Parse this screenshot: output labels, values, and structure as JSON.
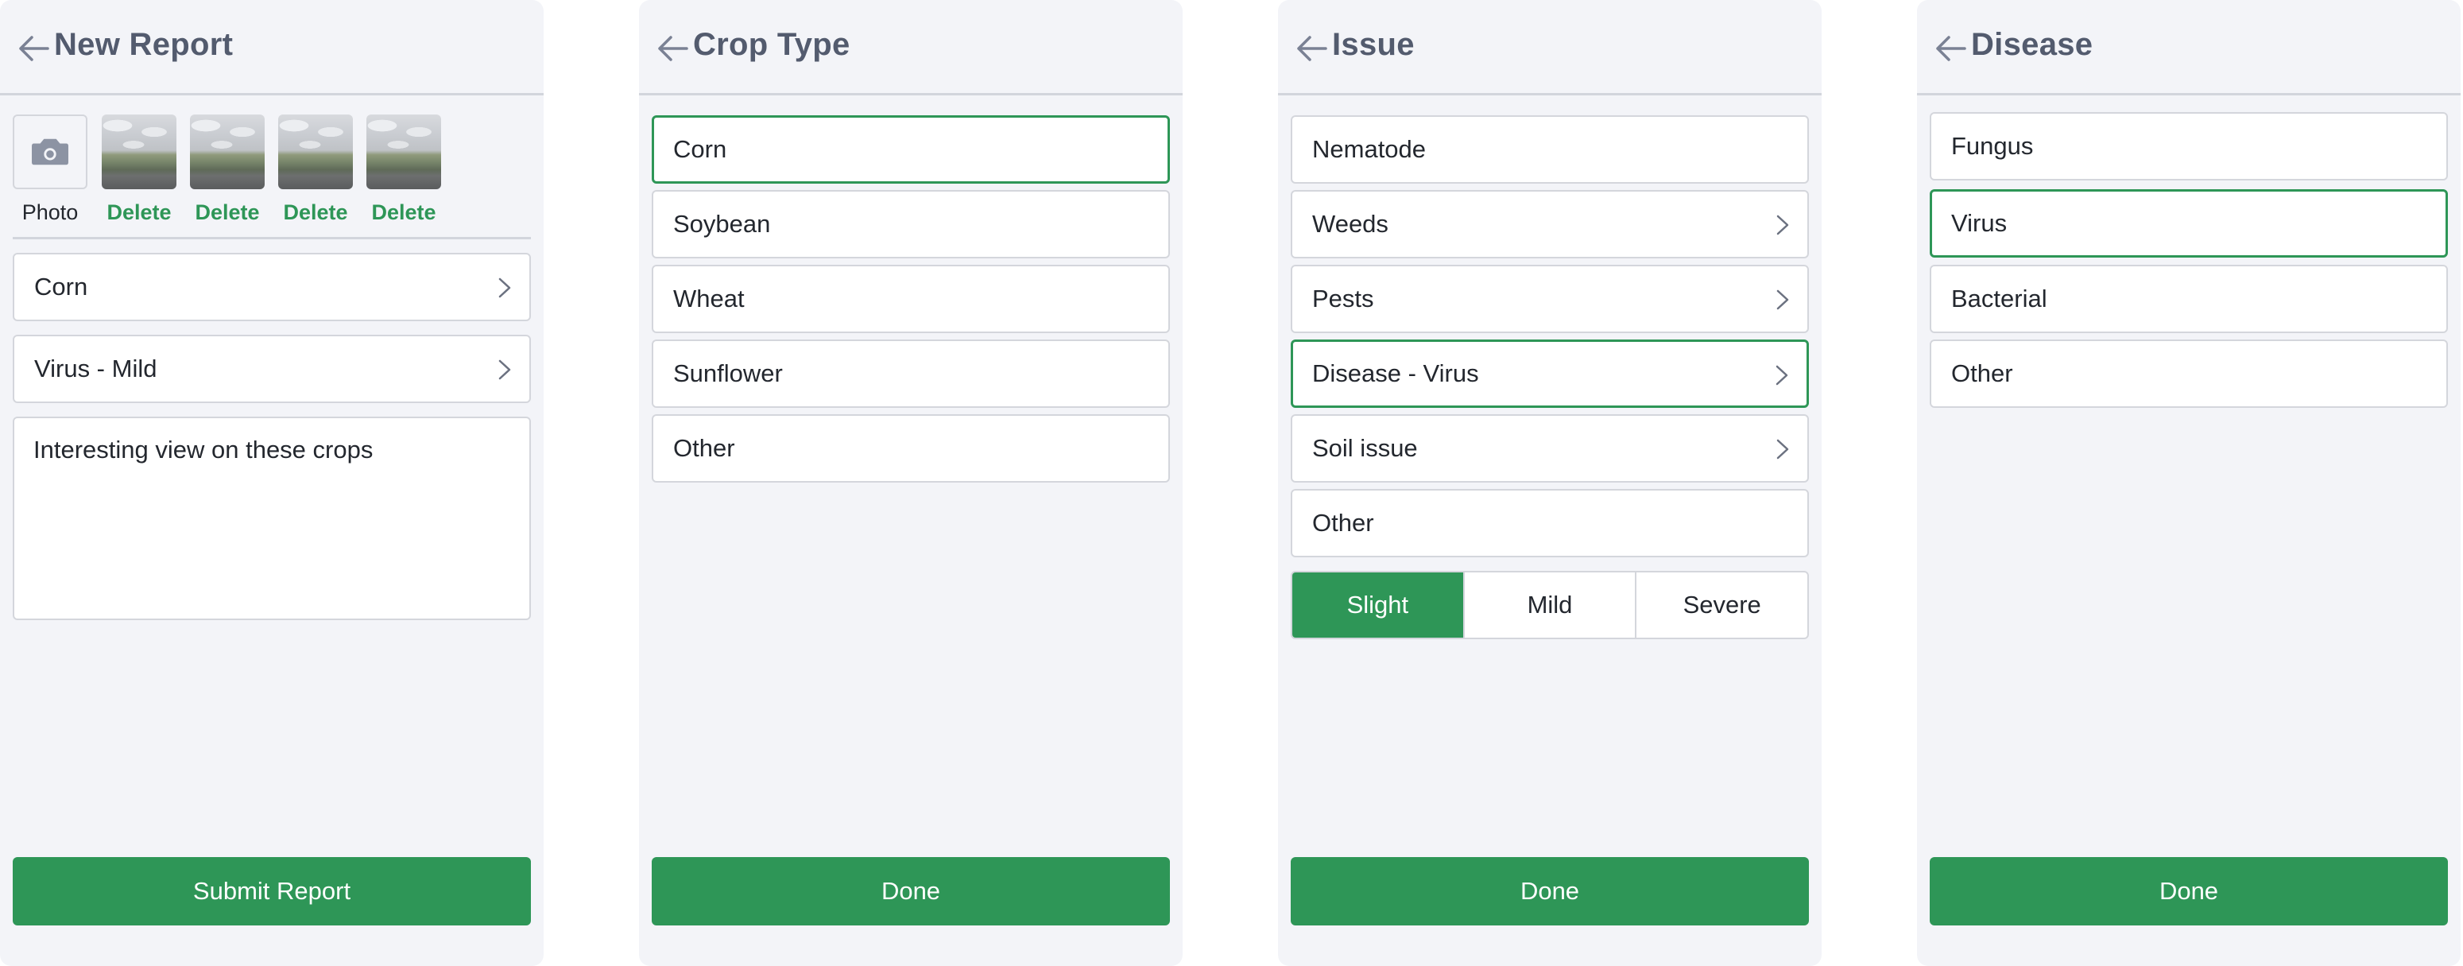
{
  "colors": {
    "accent": "#2e9657",
    "panel_bg": "#f3f4f8",
    "title": "#535b6e",
    "border": "#d4d6dc"
  },
  "new_report": {
    "title": "New Report",
    "photo_label": "Photo",
    "photo_icon": "camera-icon",
    "delete_labels": [
      "Delete",
      "Delete",
      "Delete",
      "Delete"
    ],
    "crop_value": "Corn",
    "issue_value": "Virus - Mild",
    "notes_value": "Interesting view on these crops",
    "submit_label": "Submit Report"
  },
  "crop_type": {
    "title": "Crop Type",
    "options": [
      "Corn",
      "Soybean",
      "Wheat",
      "Sunflower",
      "Other"
    ],
    "selected": "Corn",
    "done_label": "Done"
  },
  "issue": {
    "title": "Issue",
    "options": [
      "Nematode",
      "Weeds",
      "Pests",
      "Disease - Virus",
      "Soil issue",
      "Other"
    ],
    "selected": "Disease - Virus",
    "severity": [
      "Slight",
      "Mild",
      "Severe"
    ],
    "severity_selected": "Slight",
    "done_label": "Done"
  },
  "disease": {
    "title": "Disease",
    "options": [
      "Fungus",
      "Virus",
      "Bacterial",
      "Other"
    ],
    "selected": "Virus",
    "done_label": "Done"
  }
}
